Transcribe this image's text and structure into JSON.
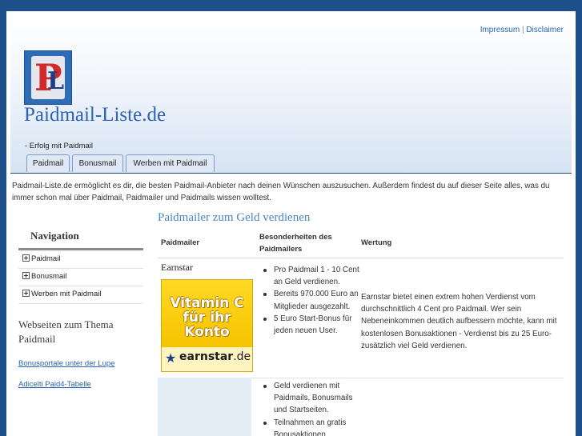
{
  "header": {
    "impressum": "Impressum",
    "separator": "|",
    "disclaimer": "Disclaimer",
    "logo_text_p": "P",
    "logo_text_l": "L",
    "site_title": "Paidmail-Liste.de",
    "slogan": "- Erfolg mit Paidmail"
  },
  "tabs": [
    "Paidmail",
    "Bonusmail",
    "Werben mit Paidmail"
  ],
  "intro": "Paidmail-Liste.de ermöglicht es dir, die besten Paidmail-Anbieter nach deinen Wünschen auszusuchen. Außerdem findest du auf dieser Seite alles, was du immer schon mal über Paidmail, Paidmailer und Paidmails wissen wolltest.",
  "sidebar": {
    "nav_title": "Navigation",
    "nav_items": [
      "Paidmail",
      "Bonusmail",
      "Werben mit Paidmail"
    ],
    "websites_title": "Webseiten zum Thema Paidmail",
    "links": [
      "Bonusportale unter der Lupe",
      "Adicelti Paid4-Tabelle"
    ]
  },
  "content": {
    "heading": "Paidmailer zum Geld verdienen",
    "columns": [
      "Paidmailer",
      "Besonderheiten des Paidmailers",
      "Wertung"
    ],
    "rows": [
      {
        "name": "Earnstar",
        "banner_line1": "Vitamin C",
        "banner_line2": "für ihr",
        "banner_line3": "Konto",
        "banner_brand_bold": "earnstar",
        "banner_brand_rest": ".de",
        "features": [
          "Pro Paidmail 1 - 10 Cent an Geld verdienen.",
          "Bereits 970.000 Euro an Mitglieder ausgezahlt.",
          "5 Euro Start-Bonus für jeden neuen User."
        ],
        "rating": "Earnstar bietet einen extrem hohen Verdienst vom durchschnittlich 4 Cent pro Paidmail. Wer sein Nebeneinkommen deutlich aufbessern möchte, kann mit kostenlosen Bonusaktionen - Verdienst bis zu 25 Euro-zusätzlich viel Geld verdienen."
      },
      {
        "features": [
          "Geld verdienen mit Paidmails, Bonusmails und Startseiten.",
          "Teilnahmen an gratis Bonusaktionen"
        ]
      }
    ]
  },
  "colors": {
    "background": "#1d4f8a",
    "link": "#2a63b5",
    "heading": "#4a86c5"
  }
}
